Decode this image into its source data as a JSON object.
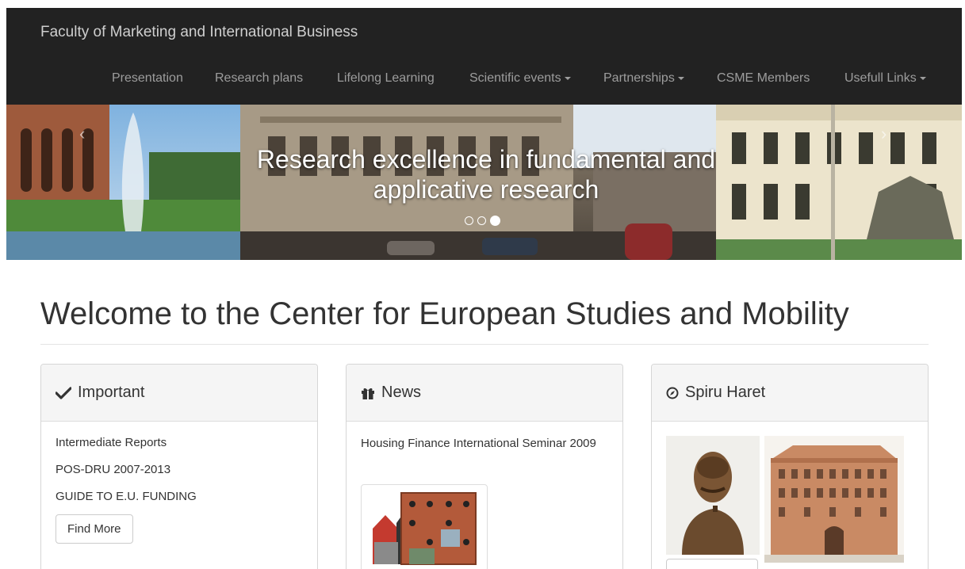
{
  "header": {
    "brand": "Faculty of Marketing and International Business",
    "menu": [
      {
        "label": "Presentation"
      },
      {
        "label": "Research plans"
      },
      {
        "label": "Lifelong Learning"
      },
      {
        "label": "Scientific events"
      },
      {
        "label": "Partnerships"
      },
      {
        "label": "CSME Members"
      },
      {
        "label": "Usefull Links"
      }
    ]
  },
  "carousel": {
    "caption": "Research excellence in fundamental and applicative research",
    "prev_glyph": "‹",
    "next_glyph": "›",
    "slide_count": 3,
    "active_slide": 3
  },
  "main": {
    "title": "Welcome to the Center for European Studies and Mobility"
  },
  "panels": {
    "important": {
      "heading": "Important",
      "items": [
        "Intermediate Reports",
        "POS-DRU 2007-2013",
        "GUIDE TO E.U. FUNDING"
      ],
      "button": "Find More"
    },
    "news": {
      "heading": "News",
      "headline": "Housing Finance International Seminar 2009"
    },
    "spiru": {
      "heading": "Spiru Haret"
    }
  },
  "colors": {
    "navbar_bg": "#222222",
    "nav_text": "#9d9d9d",
    "panel_heading_bg": "#f5f5f5"
  }
}
